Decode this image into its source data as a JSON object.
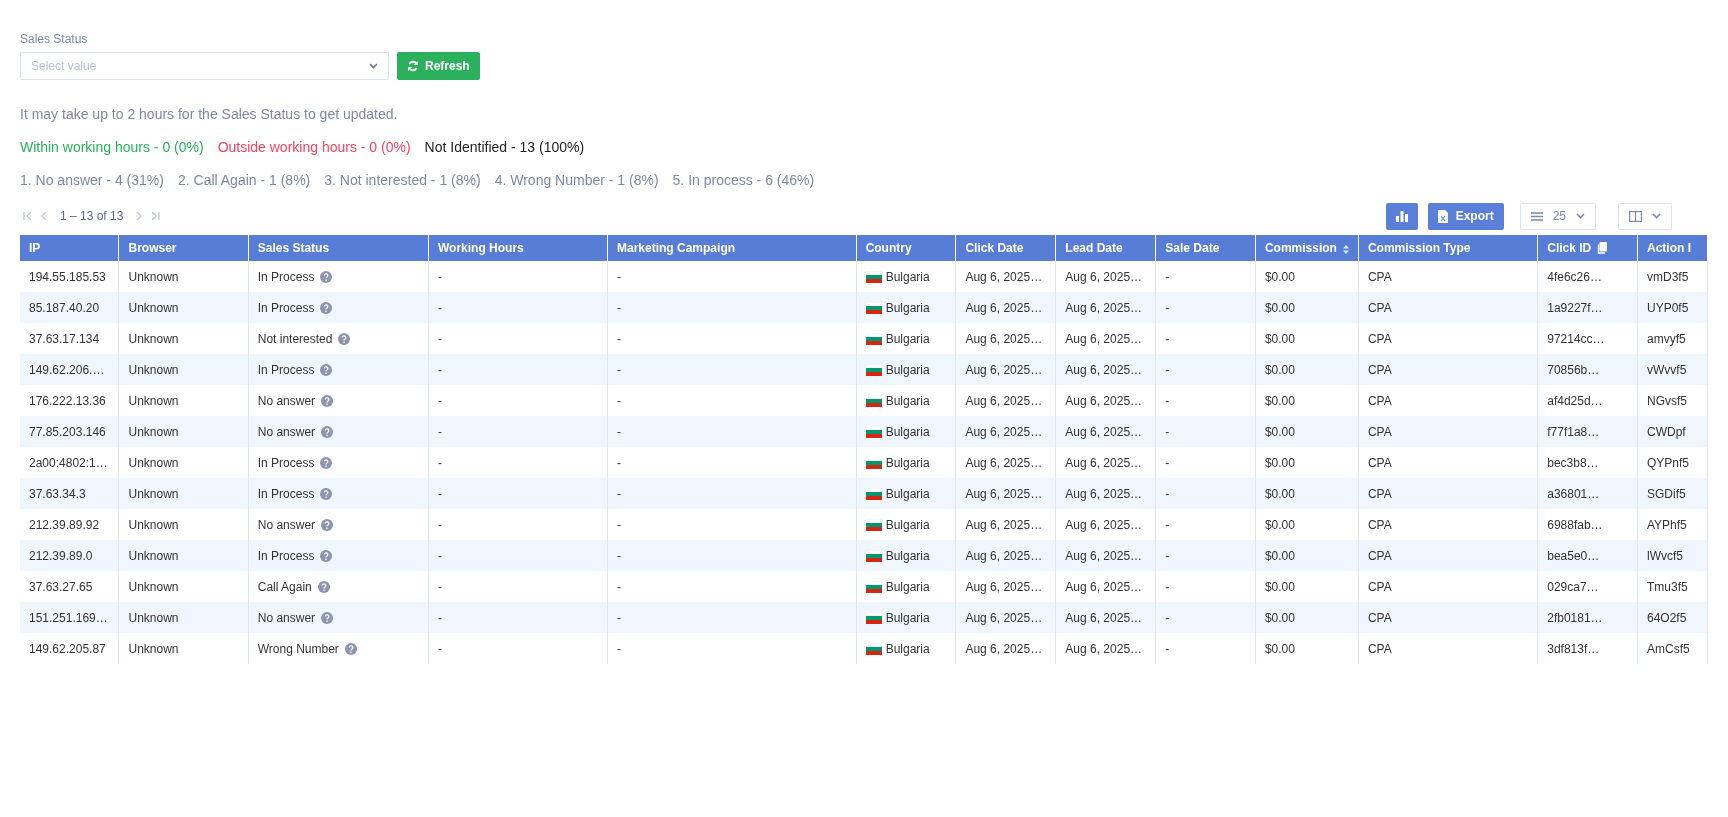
{
  "filter": {
    "label": "Sales Status",
    "placeholder": "Select value",
    "refresh_label": "Refresh"
  },
  "notice": "It may take up to 2 hours for the Sales Status to get updated.",
  "working_hours_stats": [
    {
      "text": "Within working hours - 0 (0%)",
      "color": "#28b15a"
    },
    {
      "text": "Outside working hours - 0 (0%)",
      "color": "#f2445d"
    },
    {
      "text": "Not Identified - 13 (100%)",
      "color": "#222222"
    }
  ],
  "status_stats": [
    "1. No answer - 4 (31%)",
    "2. Call Again - 1 (8%)",
    "3. Not interested - 1 (8%)",
    "4. Wrong Number - 1 (8%)",
    "5. In process - 6 (46%)"
  ],
  "pagination": {
    "range": "1 – 13 of 13",
    "buttons": [
      {
        "kind": "first",
        "disabled": true
      },
      {
        "kind": "prev",
        "disabled": true
      },
      {
        "kind": "next",
        "disabled": true
      },
      {
        "kind": "last",
        "disabled": true
      }
    ]
  },
  "toolbar": {
    "export_label": "Export",
    "page_size": "25"
  },
  "table": {
    "columns": [
      "IP",
      "Browser",
      "Sales Status",
      "Working Hours",
      "Marketing Campaign",
      "Country",
      "Click Date",
      "Lead Date",
      "Sale Date",
      "Commission",
      "Commission Type",
      "Click ID",
      "Action I"
    ],
    "rows": [
      [
        "194.55.185.53",
        "Unknown",
        "In Process",
        "-",
        "-",
        "Bulgaria",
        "Aug 6, 2025…",
        "Aug 6, 2025…",
        "-",
        "$0.00",
        "CPA",
        "4fe6c26…",
        "vmD3f5"
      ],
      [
        "85.187.40.20",
        "Unknown",
        "In Process",
        "-",
        "-",
        "Bulgaria",
        "Aug 6, 2025…",
        "Aug 6, 2025…",
        "-",
        "$0.00",
        "CPA",
        "1a9227f…",
        "UYP0f5"
      ],
      [
        "37.63.17.134",
        "Unknown",
        "Not interested",
        "-",
        "-",
        "Bulgaria",
        "Aug 6, 2025…",
        "Aug 6, 2025…",
        "-",
        "$0.00",
        "CPA",
        "97214cc…",
        "amvyf5"
      ],
      [
        "149.62.206.…",
        "Unknown",
        "In Process",
        "-",
        "-",
        "Bulgaria",
        "Aug 6, 2025…",
        "Aug 6, 2025…",
        "-",
        "$0.00",
        "CPA",
        "70856b…",
        "vWvvf5"
      ],
      [
        "176.222.13.36",
        "Unknown",
        "No answer",
        "-",
        "-",
        "Bulgaria",
        "Aug 6, 2025…",
        "Aug 6, 2025…",
        "-",
        "$0.00",
        "CPA",
        "af4d25d…",
        "NGvsf5"
      ],
      [
        "77.85.203.146",
        "Unknown",
        "No answer",
        "-",
        "-",
        "Bulgaria",
        "Aug 6, 2025…",
        "Aug 6, 2025…",
        "-",
        "$0.00",
        "CPA",
        "f77f1a8…",
        "CWDpf"
      ],
      [
        "2a00:4802:1…",
        "Unknown",
        "In Process",
        "-",
        "-",
        "Bulgaria",
        "Aug 6, 2025…",
        "Aug 6, 2025…",
        "-",
        "$0.00",
        "CPA",
        "bec3b8…",
        "QYPnf5"
      ],
      [
        "37.63.34.3",
        "Unknown",
        "In Process",
        "-",
        "-",
        "Bulgaria",
        "Aug 6, 2025…",
        "Aug 6, 2025…",
        "-",
        "$0.00",
        "CPA",
        "a36801…",
        "SGDif5"
      ],
      [
        "212.39.89.92",
        "Unknown",
        "No answer",
        "-",
        "-",
        "Bulgaria",
        "Aug 6, 2025…",
        "Aug 6, 2025…",
        "-",
        "$0.00",
        "CPA",
        "6988fab…",
        "AYPhf5"
      ],
      [
        "212.39.89.0",
        "Unknown",
        "In Process",
        "-",
        "-",
        "Bulgaria",
        "Aug 6, 2025…",
        "Aug 6, 2025…",
        "-",
        "$0.00",
        "CPA",
        "bea5e0…",
        "lWvcf5"
      ],
      [
        "37.63.27.65",
        "Unknown",
        "Call Again",
        "-",
        "-",
        "Bulgaria",
        "Aug 6, 2025…",
        "Aug 6, 2025…",
        "-",
        "$0.00",
        "CPA",
        "029ca7…",
        "Tmu3f5"
      ],
      [
        "151.251.169…",
        "Unknown",
        "No answer",
        "-",
        "-",
        "Bulgaria",
        "Aug 6, 2025…",
        "Aug 6, 2025…",
        "-",
        "$0.00",
        "CPA",
        "2fb0181…",
        "64O2f5"
      ],
      [
        "149.62.205.87",
        "Unknown",
        "Wrong Number",
        "-",
        "-",
        "Bulgaria",
        "Aug 6, 2025…",
        "Aug 6, 2025…",
        "-",
        "$0.00",
        "CPA",
        "3df813f…",
        "AmCsf5"
      ]
    ]
  }
}
